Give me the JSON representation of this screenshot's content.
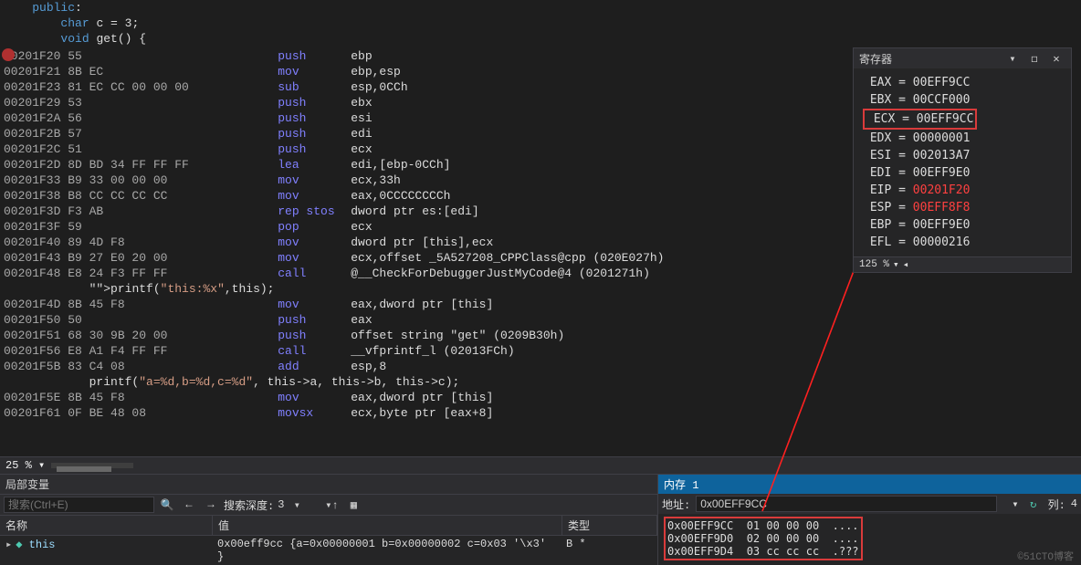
{
  "code": {
    "source_lines": [
      "    public:",
      "        char c = 3;",
      "        void get() {"
    ],
    "asm": [
      {
        "addr": "00201F20",
        "bytes": "55",
        "mnem": "push",
        "ops": "ebp",
        "bp": true
      },
      {
        "addr": "00201F21",
        "bytes": "8B EC",
        "mnem": "mov",
        "ops": "ebp,esp"
      },
      {
        "addr": "00201F23",
        "bytes": "81 EC CC 00 00 00",
        "mnem": "sub",
        "ops": "esp,0CCh"
      },
      {
        "addr": "00201F29",
        "bytes": "53",
        "mnem": "push",
        "ops": "ebx"
      },
      {
        "addr": "00201F2A",
        "bytes": "56",
        "mnem": "push",
        "ops": "esi"
      },
      {
        "addr": "00201F2B",
        "bytes": "57",
        "mnem": "push",
        "ops": "edi"
      },
      {
        "addr": "00201F2C",
        "bytes": "51",
        "mnem": "push",
        "ops": "ecx"
      },
      {
        "addr": "00201F2D",
        "bytes": "8D BD 34 FF FF FF",
        "mnem": "lea",
        "ops": "edi,[ebp-0CCh]"
      },
      {
        "addr": "00201F33",
        "bytes": "B9 33 00 00 00",
        "mnem": "mov",
        "ops": "ecx,33h"
      },
      {
        "addr": "00201F38",
        "bytes": "B8 CC CC CC CC",
        "mnem": "mov",
        "ops": "eax,0CCCCCCCCh"
      },
      {
        "addr": "00201F3D",
        "bytes": "F3 AB",
        "mnem": "rep stos",
        "ops": "dword ptr es:[edi]"
      },
      {
        "addr": "00201F3F",
        "bytes": "59",
        "mnem": "pop",
        "ops": "ecx"
      },
      {
        "addr": "00201F40",
        "bytes": "89 4D F8",
        "mnem": "mov",
        "ops": "dword ptr [this],ecx"
      },
      {
        "addr": "00201F43",
        "bytes": "B9 27 E0 20 00",
        "mnem": "mov",
        "ops": "ecx,offset _5A527208_CPPClass@cpp (020E027h)"
      },
      {
        "addr": "00201F48",
        "bytes": "E8 24 F3 FF FF",
        "mnem": "call",
        "ops": "@__CheckForDebuggerJustMyCode@4 (0201271h)"
      }
    ],
    "source_mid": "            printf(\"this:%x\",this);",
    "asm2": [
      {
        "addr": "00201F4D",
        "bytes": "8B 45 F8",
        "mnem": "mov",
        "ops": "eax,dword ptr [this]"
      },
      {
        "addr": "00201F50",
        "bytes": "50",
        "mnem": "push",
        "ops": "eax"
      },
      {
        "addr": "00201F51",
        "bytes": "68 30 9B 20 00",
        "mnem": "push",
        "ops": "offset string \"get\" (0209B30h)"
      },
      {
        "addr": "00201F56",
        "bytes": "E8 A1 F4 FF FF",
        "mnem": "call",
        "ops": "__vfprintf_l (02013FCh)"
      },
      {
        "addr": "00201F5B",
        "bytes": "83 C4 08",
        "mnem": "add",
        "ops": "esp,8"
      }
    ],
    "source_bot": "            printf(\"a=%d,b=%d,c=%d\", this->a, this->b, this->c);",
    "asm3": [
      {
        "addr": "00201F5E",
        "bytes": "8B 45 F8",
        "mnem": "mov",
        "ops": "eax,dword ptr [this]"
      },
      {
        "addr": "00201F61",
        "bytes": "0F BE 48 08",
        "mnem": "movsx",
        "ops": "ecx,byte ptr [eax+8]"
      }
    ]
  },
  "zoom_main": "25 %",
  "locals": {
    "title": "局部变量",
    "search_placeholder": "搜索(Ctrl+E)",
    "depth_label": "搜索深度:",
    "depth_value": "3",
    "col_name": "名称",
    "col_value": "值",
    "col_type": "类型",
    "row": {
      "name": "this",
      "value": "0x00eff9cc {a=0x00000001 b=0x00000002 c=0x03 '\\x3' }",
      "type": "B *"
    }
  },
  "memory": {
    "title": "内存 1",
    "addr_label": "地址:",
    "addr_value": "0x00EFF9CC",
    "col_label": "列:",
    "col_value": "4",
    "lines": [
      {
        "a": "0x00EFF9CC",
        "b": "01 00 00 00",
        "c": "...."
      },
      {
        "a": "0x00EFF9D0",
        "b": "02 00 00 00",
        "c": "...."
      },
      {
        "a": "0x00EFF9D4",
        "b": "03 cc cc cc",
        "c": ".???"
      }
    ]
  },
  "registers": {
    "title": "寄存器",
    "regs": [
      {
        "n": "EAX",
        "v": "00EFF9CC"
      },
      {
        "n": "EBX",
        "v": "00CCF000"
      },
      {
        "n": "ECX",
        "v": "00EFF9CC",
        "boxed": true
      },
      {
        "n": "EDX",
        "v": "00000001"
      },
      {
        "n": "ESI",
        "v": "002013A7"
      },
      {
        "n": "EDI",
        "v": "00EFF9E0"
      },
      {
        "n": "EIP",
        "v": "00201F20",
        "hl": true
      },
      {
        "n": "ESP",
        "v": "00EFF8F8",
        "hl": true
      },
      {
        "n": "EBP",
        "v": "00EFF9E0"
      },
      {
        "n": "EFL",
        "v": "00000216"
      }
    ],
    "zoom": "125 %"
  },
  "watermark": "©51CTO博客"
}
